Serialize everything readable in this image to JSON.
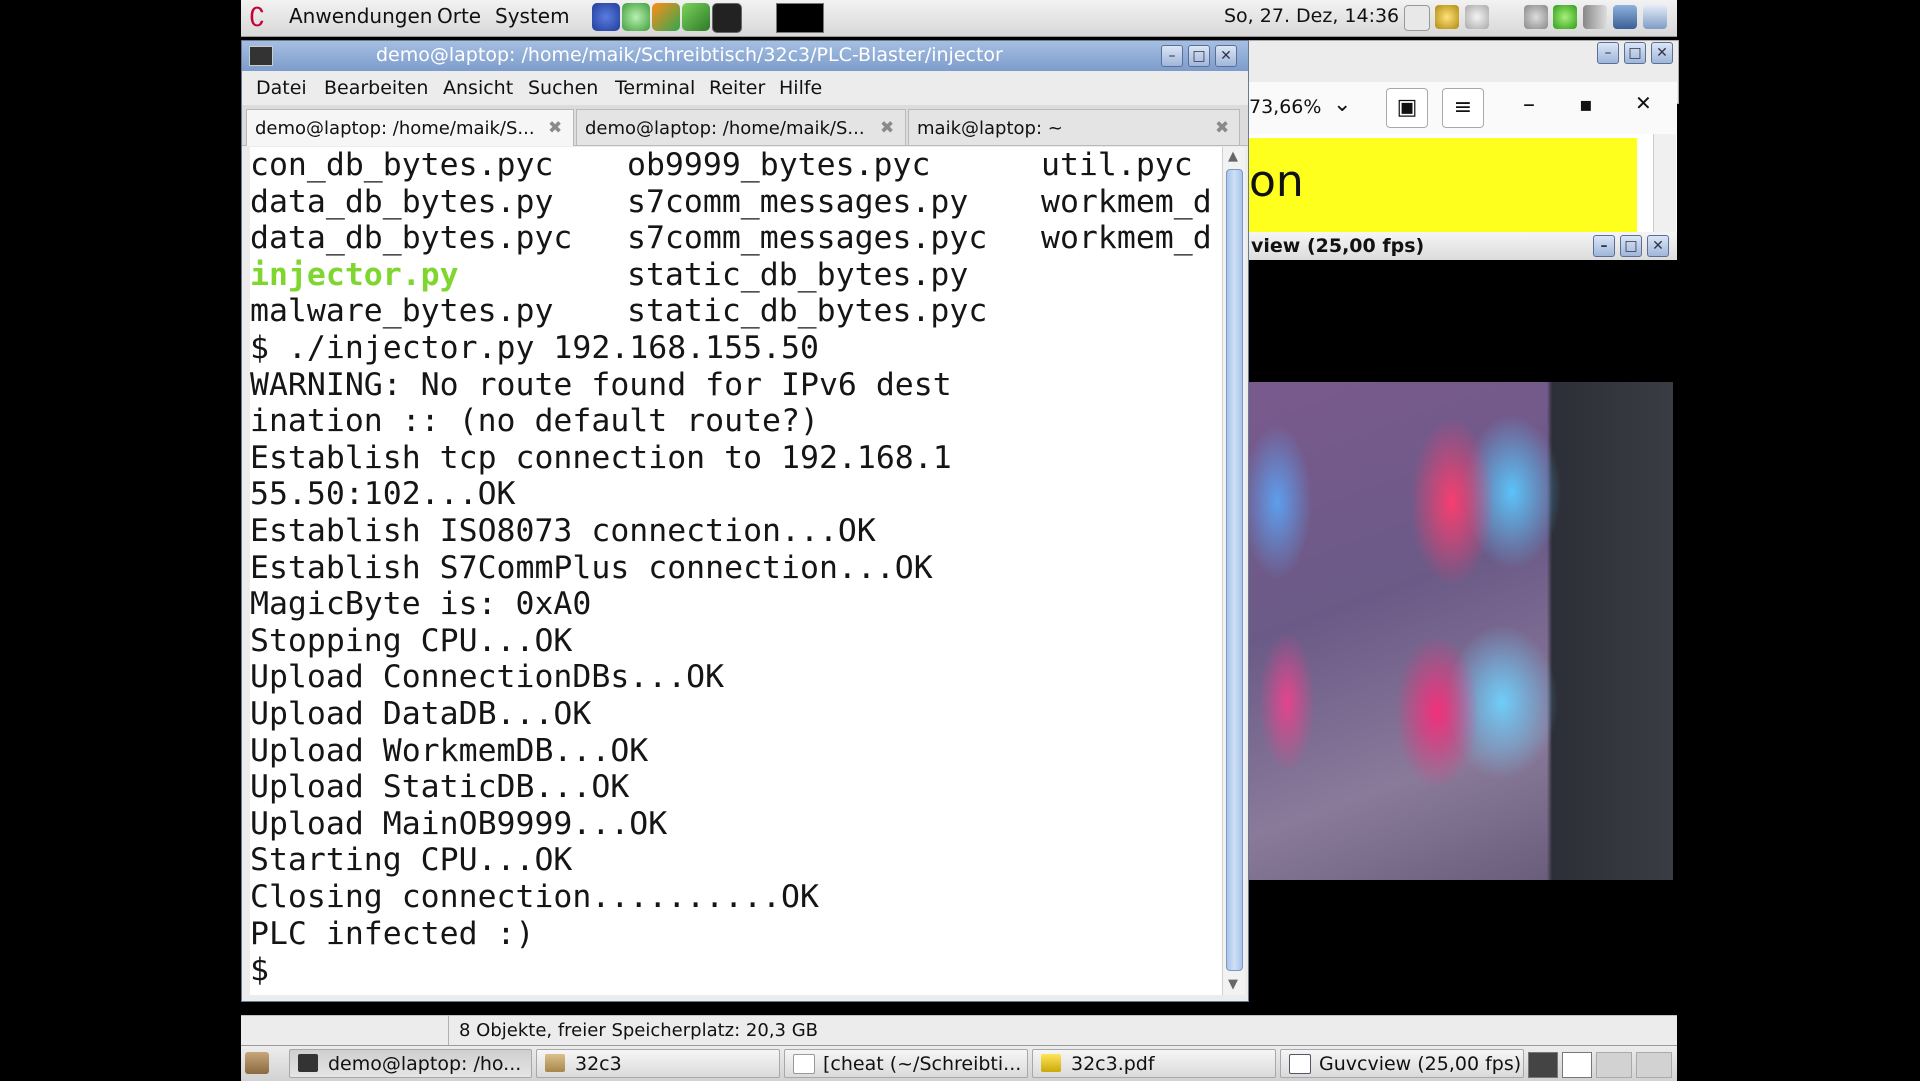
{
  "top_panel": {
    "menus": [
      "Anwendungen",
      "Orte",
      "System"
    ],
    "clock": "So, 27. Dez, 14:36"
  },
  "terminal_window": {
    "title": "demo@laptop: /home/maik/Schreibtisch/32c3/PLC-Blaster/injector",
    "menu": [
      "Datei",
      "Bearbeiten",
      "Ansicht",
      "Suchen",
      "Terminal",
      "Reiter",
      "Hilfe"
    ],
    "tabs": [
      {
        "label": "demo@laptop: /home/maik/S...",
        "active": true
      },
      {
        "label": "demo@laptop: /home/maik/S...",
        "active": false
      },
      {
        "label": "maik@laptop: ~",
        "active": false
      }
    ],
    "listing_rows": [
      [
        "con_db_bytes.pyc",
        "ob9999_bytes.pyc",
        "util.pyc"
      ],
      [
        "data_db_bytes.py",
        "s7comm_messages.py",
        "workmem_d"
      ],
      [
        "data_db_bytes.pyc",
        "s7comm_messages.pyc",
        "workmem_d"
      ],
      [
        "injector.py",
        "static_db_bytes.py",
        ""
      ],
      [
        "malware_bytes.py",
        "static_db_bytes.pyc",
        ""
      ]
    ],
    "output_lines": [
      "$ ./injector.py 192.168.155.50",
      "WARNING: No route found for IPv6 dest",
      "ination :: (no default route?)",
      "Establish tcp connection to 192.168.1",
      "55.50:102...OK",
      "Establish ISO8073 connection...OK",
      "Establish S7CommPlus connection...OK",
      "MagicByte is: 0xA0",
      "Stopping CPU...OK",
      "Upload ConnectionDBs...OK",
      "Upload DataDB...OK",
      "Upload WorkmemDB...OK",
      "Upload StaticDB...OK",
      "Upload MainOB9999...OK",
      "Starting CPU...OK",
      "Closing connection..........OK",
      "PLC infected :)",
      "$"
    ]
  },
  "pdf_viewer": {
    "zoom": "73,66%",
    "page_text": "on"
  },
  "guvcview": {
    "title": "view  (25,00 fps)"
  },
  "status_bar": {
    "text": "8 Objekte, freier Speicherplatz: 20,3 GB"
  },
  "taskbar": {
    "tasks": [
      {
        "label": "demo@laptop: /ho...",
        "active": true,
        "icon": "terminal-icon"
      },
      {
        "label": "32c3",
        "active": false,
        "icon": "folder-icon"
      },
      {
        "label": "[cheat (~/Schreibti...",
        "active": false,
        "icon": "text-editor-icon"
      },
      {
        "label": "32c3.pdf",
        "active": false,
        "icon": "pdf-icon"
      },
      {
        "label": "Guvcview  (25,00 fps)",
        "active": false,
        "icon": "window-icon"
      }
    ]
  },
  "colors": {
    "titlebar": "#7d9ccb",
    "executable_file": "#7fd62f",
    "pdf_highlight": "#ffff1e"
  }
}
